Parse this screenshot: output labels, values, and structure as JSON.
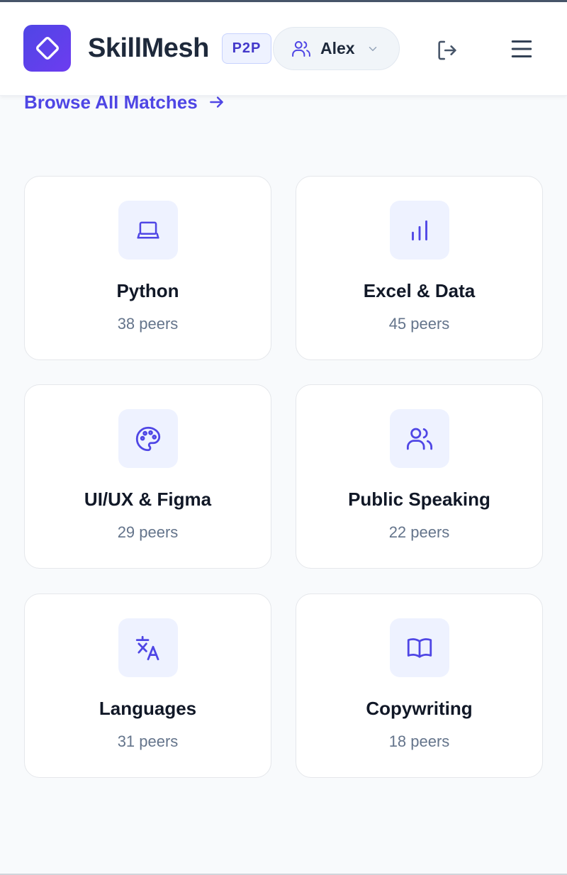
{
  "header": {
    "brand": "SkillMesh",
    "badge": "P2P",
    "user": {
      "name": "Alex"
    }
  },
  "browse": {
    "label": "Browse All Matches"
  },
  "colors": {
    "accent": "#4f46e5",
    "tile_bg": "#eef2ff",
    "muted": "#64748b"
  },
  "categories": [
    {
      "title": "Python",
      "peers": "38 peers",
      "icon": "laptop-icon"
    },
    {
      "title": "Excel & Data",
      "peers": "45 peers",
      "icon": "bar-chart-icon"
    },
    {
      "title": "UI/UX & Figma",
      "peers": "29 peers",
      "icon": "palette-icon"
    },
    {
      "title": "Public Speaking",
      "peers": "22 peers",
      "icon": "users-icon"
    },
    {
      "title": "Languages",
      "peers": "31 peers",
      "icon": "translate-icon"
    },
    {
      "title": "Copywriting",
      "peers": "18 peers",
      "icon": "book-open-icon"
    }
  ]
}
